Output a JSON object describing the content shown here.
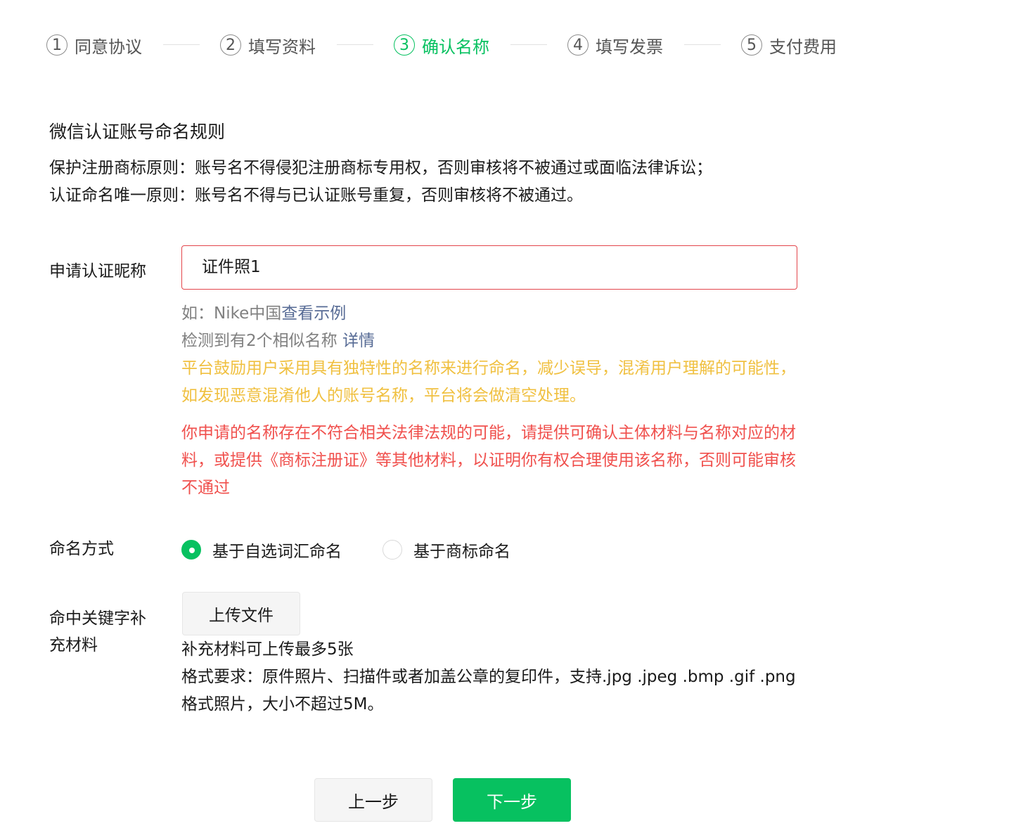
{
  "colors": {
    "accent": "#07c160",
    "link": "#576b95",
    "warning": "#f0c040",
    "error": "#f0504d",
    "muted": "#808080"
  },
  "stepper": {
    "active_index": 2,
    "steps": [
      {
        "num": "1",
        "label": "同意协议"
      },
      {
        "num": "2",
        "label": "填写资料"
      },
      {
        "num": "3",
        "label": "确认名称"
      },
      {
        "num": "4",
        "label": "填写发票"
      },
      {
        "num": "5",
        "label": "支付费用"
      }
    ]
  },
  "rules": {
    "title": "微信认证账号命名规则",
    "lines": [
      "保护注册商标原则：账号名不得侵犯注册商标专用权，否则审核将不被通过或面临法律诉讼；",
      "认证命名唯一原则：账号名不得与已认证账号重复，否则审核将不被通过。"
    ]
  },
  "nickname": {
    "label": "申请认证昵称",
    "value": "证件照1",
    "example_prefix": "如：Nike中国",
    "example_link": "查看示例",
    "similar_text": "检测到有2个相似名称",
    "similar_link": "详情",
    "warning_lines": [
      "平台鼓励用户采用具有独特性的名称来进行命名，减少误导，混淆用户理解的可能性，",
      "如发现恶意混淆他人的账号名称，平台将会做清空处理。"
    ],
    "error_lines": [
      "你申请的名称存在不符合相关法律法规的可能，请提供可确认主体材料与名称对应的材",
      "料，或提供《商标注册证》等其他材料，以证明你有权合理使用该名称，否则可能审核",
      "不通过"
    ]
  },
  "naming": {
    "label": "命名方式",
    "options": [
      {
        "label": "基于自选词汇命名",
        "checked": true
      },
      {
        "label": "基于商标命名",
        "checked": false
      }
    ]
  },
  "supplement": {
    "label_lines": [
      "命中关键字补",
      "充材料"
    ],
    "upload_label": "上传文件",
    "notes": [
      "补充材料可上传最多5张",
      "格式要求：原件照片、扫描件或者加盖公章的复印件，支持.jpg .jpeg .bmp .gif .png",
      "格式照片，大小不超过5M。"
    ]
  },
  "footer": {
    "prev_label": "上一步",
    "next_label": "下一步"
  }
}
